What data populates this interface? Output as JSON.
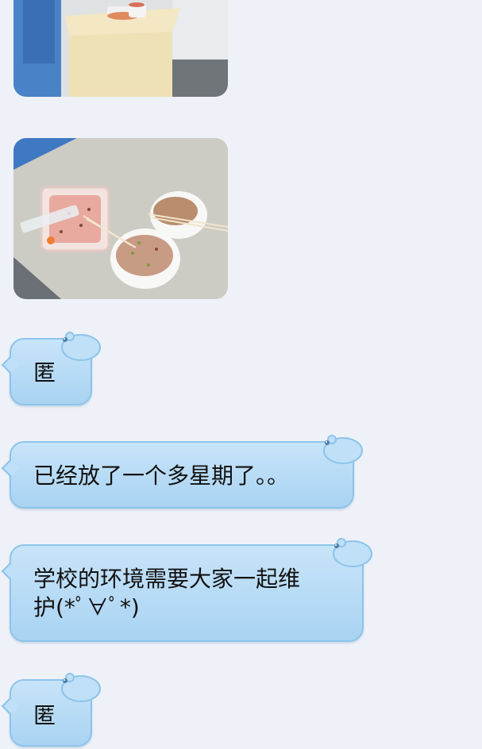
{
  "messages": [
    {
      "type": "image",
      "icon": "desk-food-containers-photo"
    },
    {
      "type": "image",
      "icon": "leftover-noodle-bowls-photo"
    },
    {
      "type": "text",
      "text": "匿"
    },
    {
      "type": "text",
      "text": "已经放了一个多星期了。。"
    },
    {
      "type": "text",
      "text": "学校的环境需要大家一起维\n护(*ﾟ∀ﾟ*)"
    },
    {
      "type": "text",
      "text": "匿"
    }
  ],
  "colors": {
    "background": "#eef1f8",
    "bubble_fill": "#b9ddf6",
    "bubble_border": "#8cc4ea"
  }
}
